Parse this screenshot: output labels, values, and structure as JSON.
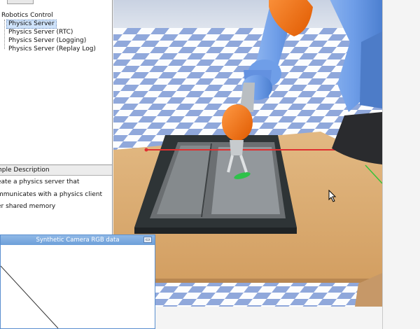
{
  "tree": {
    "root": "Robotics Control",
    "items": [
      {
        "label": "Physics Server",
        "selected": true
      },
      {
        "label": "Physics Server (RTC)",
        "selected": false
      },
      {
        "label": "Physics Server (Logging)",
        "selected": false
      },
      {
        "label": "Physics Server (Replay Log)",
        "selected": false
      }
    ]
  },
  "description": {
    "header": "mple Description",
    "lines": [
      "eate a physics server that",
      "mmunicates with a physics client",
      "er shared memory"
    ]
  },
  "camera_window": {
    "title": "Synthetic Camera RGB data",
    "button_icon": "minimize-icon"
  },
  "scene": {
    "floor_colors": [
      "#7f9bd6",
      "#ffffff"
    ],
    "table_color": "#d8a86f",
    "robot_orange": "#f26a10",
    "robot_blue": "#6f9ee8",
    "laser_color": "#e03030"
  }
}
